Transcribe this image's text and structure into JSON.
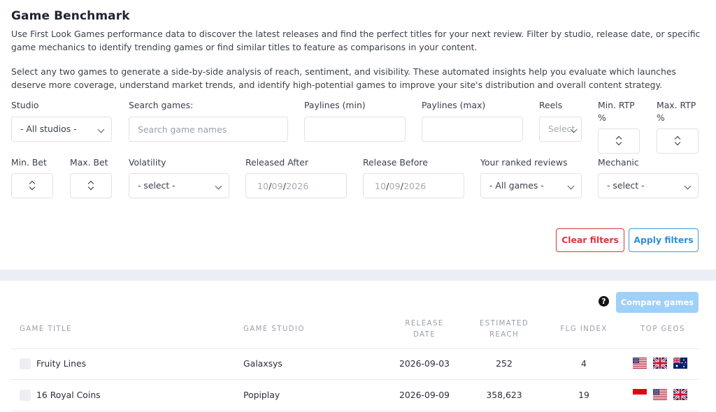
{
  "page": {
    "title": "Game Benchmark",
    "description_1": "Use First Look Games performance data to discover the latest releases and find the perfect titles for your next review. Filter by studio, release date, or specific game mechanics to identify trending games or find similar titles to feature as comparisons in your content.",
    "description_2": "Select any two games to generate a side-by-side analysis of reach, sentiment, and visibility. These automated insights help you evaluate which launches deserve more coverage, understand market trends, and identify high-potential games to improve your site's distribution and overall content strategy."
  },
  "filters": {
    "studio": {
      "label": "Studio",
      "value": "- All studios -"
    },
    "search": {
      "label": "Search games:",
      "placeholder": "Search game names"
    },
    "paylines_min": {
      "label": "Paylines (min)"
    },
    "paylines_max": {
      "label": "Paylines (max)"
    },
    "reels": {
      "label": "Reels",
      "value": "Select"
    },
    "min_rtp": {
      "label_1": "Min. RTP",
      "label_2": "%"
    },
    "max_rtp": {
      "label_1": "Max. RTP",
      "label_2": "%"
    },
    "min_bet": {
      "label": "Min. Bet"
    },
    "max_bet": {
      "label": "Max. Bet"
    },
    "volatility": {
      "label": "Volatility",
      "value": "- select -"
    },
    "released_after": {
      "label": "Released After",
      "day": "10",
      "month": "09",
      "year": "2026"
    },
    "release_before": {
      "label": "Release Before",
      "day": "10",
      "month": "09",
      "year": "2026"
    },
    "ranked_reviews": {
      "label": "Your ranked reviews",
      "value": "- All games -"
    },
    "mechanic": {
      "label": "Mechanic",
      "value": "- select -"
    },
    "clear_label": "Clear filters",
    "apply_label": "Apply filters"
  },
  "results": {
    "help_glyph": "?",
    "compare_label": "Compare games",
    "columns": {
      "title": "Game Title",
      "studio": "Game Studio",
      "release_1": "Release",
      "release_2": "Date",
      "reach_1": "Estimated",
      "reach_2": "Reach",
      "index": "FLG Index",
      "geos": "Top Geos"
    },
    "rows": [
      {
        "title": "Fruity Lines",
        "studio": "Galaxsys",
        "release_date": "2026-09-03",
        "reach": "252",
        "index": "4",
        "geos": [
          "us-flag-icon",
          "uk-flag-icon",
          "au-flag-icon"
        ]
      },
      {
        "title": "16 Royal Coins",
        "studio": "Popiplay",
        "release_date": "2026-09-09",
        "reach": "358,623",
        "index": "19",
        "geos": [
          "id-flag-icon",
          "us-flag-icon",
          "uk-flag-icon"
        ]
      }
    ]
  },
  "colors": {
    "clear": "#d9363e",
    "apply": "#2f8fd4",
    "compare": "#9fd0f7",
    "band": "#eceef6"
  }
}
